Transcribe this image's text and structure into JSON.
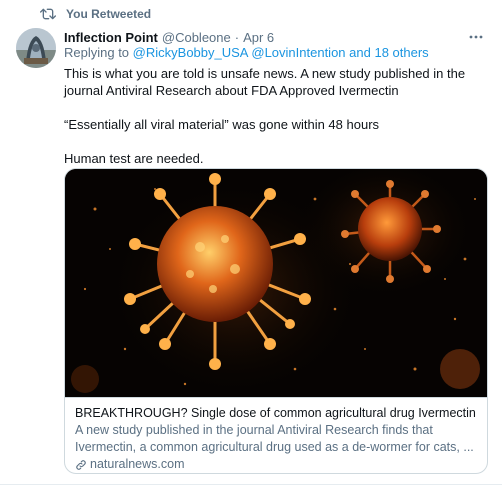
{
  "retweet": {
    "label": "You Retweeted"
  },
  "tweet": {
    "display_name": "Inflection Point",
    "handle": "@Cobleone",
    "separator": "·",
    "date": "Apr 6",
    "replying": {
      "prefix": "Replying to",
      "user1": "@RickyBobby_USA",
      "user2": "@LovinIntention",
      "conjunction": "and",
      "others": "18 others"
    },
    "text": {
      "line1": "This is what you are told is unsafe news.  A new study published in the journal Antiviral Research about FDA Approved Ivermectin",
      "line2": "“Essentially all viral material” was gone within 48 hours",
      "line3": "Human test are needed."
    }
  },
  "card": {
    "title": "BREAKTHROUGH? Single dose of common agricultural drug Ivermectin ...",
    "description": "A new study published in the journal Antiviral Research finds that Ivermectin, a common agricultural drug used as a de-wormer for cats, ...",
    "domain": "naturalnews.com"
  },
  "icons": {
    "retweet": "retweet-icon",
    "more": "more-icon",
    "link": "link-icon"
  },
  "colors": {
    "link": "#1b95e0",
    "secondary_text": "#5b7083",
    "primary_text": "#0f1419",
    "border": "#cfd9de"
  }
}
